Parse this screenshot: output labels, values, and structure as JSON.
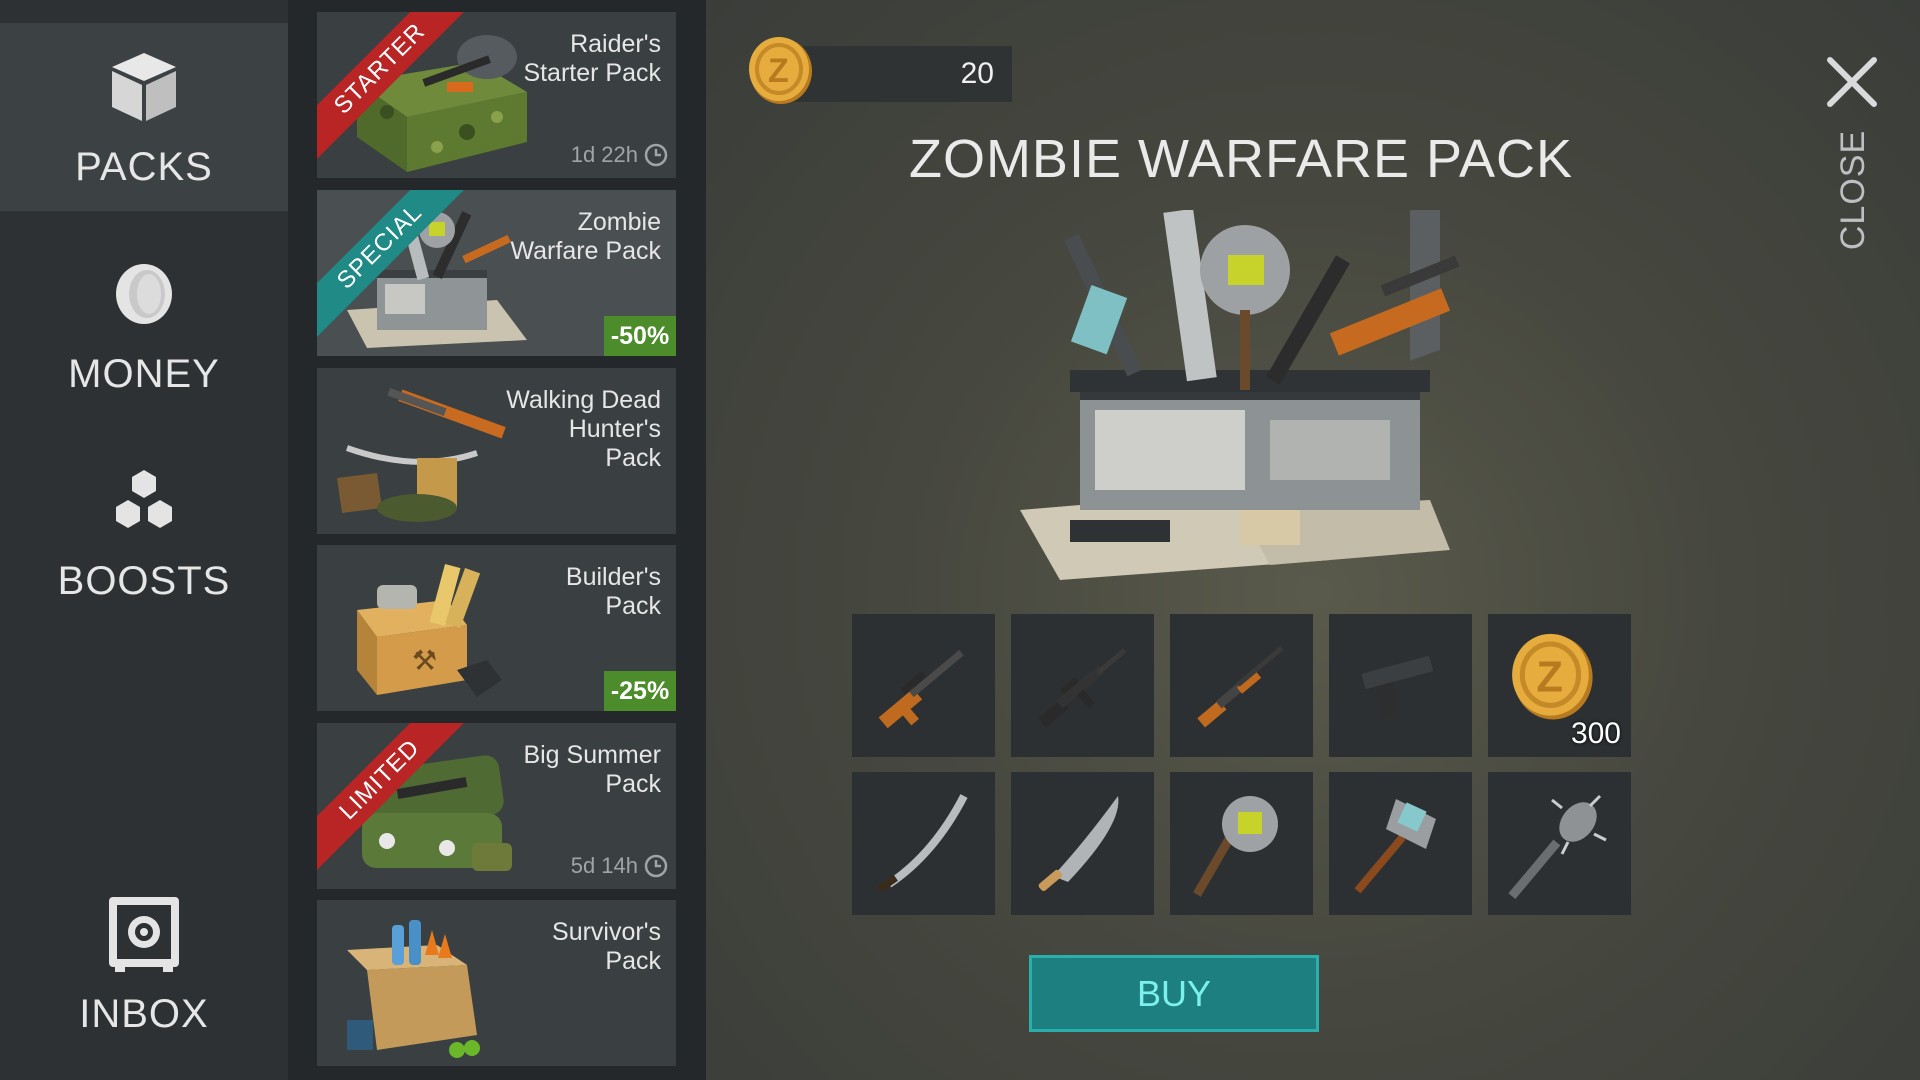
{
  "sidebar": {
    "items": [
      {
        "label": "PACKS",
        "icon": "box-icon",
        "selected": true
      },
      {
        "label": "MONEY",
        "icon": "coin-icon",
        "selected": false
      },
      {
        "label": "BOOSTS",
        "icon": "boosts-icon",
        "selected": false
      },
      {
        "label": "INBOX",
        "icon": "safe-icon",
        "selected": false
      }
    ]
  },
  "packs": [
    {
      "name": "Raider's\nStarter Pack",
      "ribbon": "STARTER",
      "ribbon_color": "#b92424",
      "timer": "1d 22h",
      "discount": null
    },
    {
      "name": "Zombie\nWarfare Pack",
      "ribbon": "SPECIAL",
      "ribbon_color": "#1f8a86",
      "timer": null,
      "discount": "-50%",
      "selected": true
    },
    {
      "name": "Walking Dead\nHunter's\nPack",
      "ribbon": null,
      "timer": null,
      "discount": null
    },
    {
      "name": "Builder's\nPack",
      "ribbon": null,
      "timer": null,
      "discount": "-25%"
    },
    {
      "name": "Big Summer\nPack",
      "ribbon": "LIMITED",
      "ribbon_color": "#b92424",
      "timer": "5d 14h",
      "discount": null
    },
    {
      "name": "Survivor's\nPack",
      "ribbon": null,
      "timer": null,
      "discount": null
    }
  ],
  "currency": {
    "value": "20",
    "icon": "zcoin-icon"
  },
  "detail": {
    "title": "ZOMBIE WARFARE PACK",
    "close_label": "CLOSE",
    "buy_label": "BUY",
    "items": [
      {
        "icon": "sniper-rifle-icon",
        "qty": null
      },
      {
        "icon": "assault-rifle-icon",
        "qty": null
      },
      {
        "icon": "shotgun-icon",
        "qty": null
      },
      {
        "icon": "pistol-icon",
        "qty": null
      },
      {
        "icon": "zcoin-icon",
        "qty": "300"
      },
      {
        "icon": "katana-icon",
        "qty": null
      },
      {
        "icon": "machete-icon",
        "qty": null
      },
      {
        "icon": "sawblade-axe-icon",
        "qty": null
      },
      {
        "icon": "sledgehammer-icon",
        "qty": null
      },
      {
        "icon": "spiked-club-icon",
        "qty": null
      }
    ]
  },
  "colors": {
    "accent_teal": "#1e7f80",
    "buy_text": "#7cf0ec",
    "ribbon_red": "#b92424",
    "ribbon_teal": "#1f8a86",
    "discount_green": "#4d8c2a",
    "coin_gold": "#e0a83a"
  }
}
